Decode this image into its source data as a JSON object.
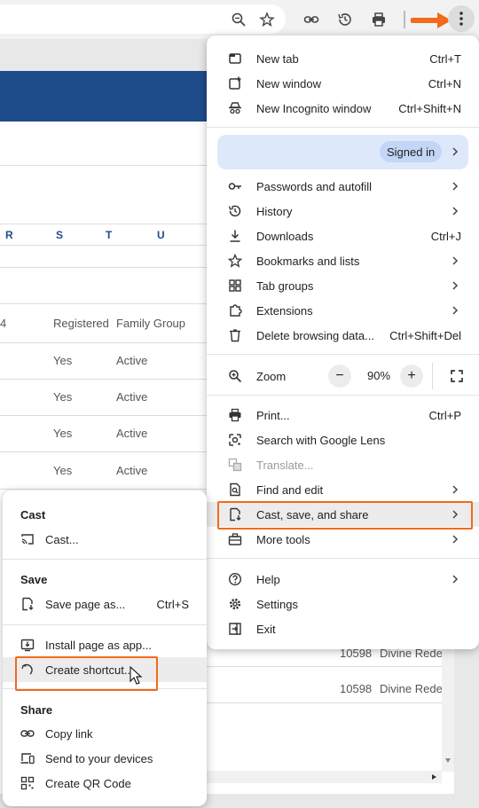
{
  "table": {
    "headers": [
      "R",
      "S",
      "T",
      "U"
    ],
    "header_row": {
      "c0": "4",
      "registered": "Registered",
      "family_group": "Family Group"
    },
    "rows": [
      {
        "registered": "Yes",
        "status": "Active"
      },
      {
        "registered": "Yes",
        "status": "Active"
      },
      {
        "registered": "Yes",
        "status": "Active"
      },
      {
        "registered": "Yes",
        "status": "Active"
      }
    ],
    "lower_rows": [
      {
        "num": "10598",
        "name": "Divine Redee"
      },
      {
        "num": "10598",
        "name": "Divine Redee"
      }
    ]
  },
  "chrome_menu": {
    "new_tab": "New tab",
    "new_tab_sc": "Ctrl+T",
    "new_window": "New window",
    "new_window_sc": "Ctrl+N",
    "incognito": "New Incognito window",
    "incognito_sc": "Ctrl+Shift+N",
    "signed_in": "Signed in",
    "passwords": "Passwords and autofill",
    "history": "History",
    "downloads": "Downloads",
    "downloads_sc": "Ctrl+J",
    "bookmarks": "Bookmarks and lists",
    "tab_groups": "Tab groups",
    "extensions": "Extensions",
    "delete_data": "Delete browsing data...",
    "delete_data_sc": "Ctrl+Shift+Del",
    "zoom": "Zoom",
    "zoom_minus": "−",
    "zoom_value": "90%",
    "zoom_plus": "+",
    "print": "Print...",
    "print_sc": "Ctrl+P",
    "lens": "Search with Google Lens",
    "translate": "Translate...",
    "find_edit": "Find and edit",
    "cast_save_share": "Cast, save, and share",
    "more_tools": "More tools",
    "help": "Help",
    "settings": "Settings",
    "exit": "Exit"
  },
  "submenu": {
    "cast_header": "Cast",
    "cast": "Cast...",
    "save_header": "Save",
    "save_page": "Save page as...",
    "save_page_sc": "Ctrl+S",
    "install": "Install page as app...",
    "create_shortcut": "Create shortcut...",
    "share_header": "Share",
    "copy_link": "Copy link",
    "send_devices": "Send to your devices",
    "qr": "Create QR Code"
  },
  "colors": {
    "accent_orange": "#f26a1b",
    "banner_blue": "#1e4b8a",
    "signed_in_bg": "#dde8fb"
  }
}
